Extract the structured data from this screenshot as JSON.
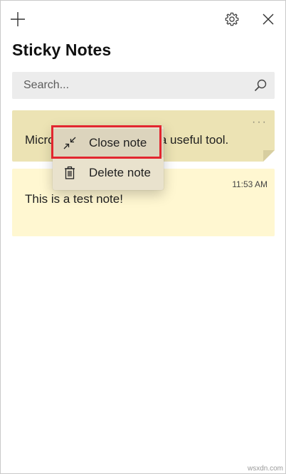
{
  "app": {
    "title": "Sticky Notes"
  },
  "titlebar": {
    "add_icon": "plus-icon",
    "settings_icon": "gear-icon",
    "close_icon": "close-icon"
  },
  "search": {
    "placeholder": "Search...",
    "value": ""
  },
  "notes": [
    {
      "text": "Microsoft Sticky Notes is a useful tool.",
      "color": "#ece3b4",
      "more_label": "···"
    },
    {
      "text": "This is a test note!",
      "time": "11:53 AM",
      "color": "#fff7d1"
    }
  ],
  "context_menu": {
    "items": [
      {
        "label": "Close note",
        "icon": "close-note-icon"
      },
      {
        "label": "Delete note",
        "icon": "trash-icon"
      }
    ]
  },
  "highlight_color": "#e2262f",
  "watermark": "wsxdn.com"
}
